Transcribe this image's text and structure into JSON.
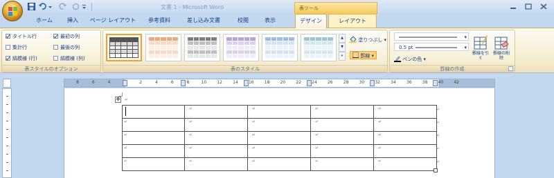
{
  "window": {
    "title": "文書 1 - Microsoft Word",
    "context_group": "表ツール"
  },
  "tabs": [
    {
      "label": "ホーム"
    },
    {
      "label": "挿入"
    },
    {
      "label": "ページ レイアウト"
    },
    {
      "label": "参考資料"
    },
    {
      "label": "差し込み文書"
    },
    {
      "label": "校閲"
    },
    {
      "label": "表示"
    },
    {
      "label": "デザイン"
    },
    {
      "label": "レイアウト"
    }
  ],
  "active_tab": "デザイン",
  "ribbon": {
    "style_options": {
      "label": "表スタイルのオプション",
      "items": [
        {
          "label": "タイトル行",
          "checked": true
        },
        {
          "label": "最初の列",
          "checked": true
        },
        {
          "label": "集計行",
          "checked": false
        },
        {
          "label": "最後の列",
          "checked": false
        },
        {
          "label": "縞模様 (行)",
          "checked": true
        },
        {
          "label": "縞模様 (列)",
          "checked": false
        }
      ]
    },
    "table_styles": {
      "label": "表のスタイル",
      "shading_label": "塗りつぶし",
      "borders_label": "罫線",
      "styles": [
        {
          "name": "grid-plain",
          "header": "#555555",
          "band": "#d9d9d9",
          "cell": "#ffffff"
        },
        {
          "name": "orange-grid",
          "header": "#f2a77a",
          "band": "#fbd9c4",
          "cell": "#fdeee4"
        },
        {
          "name": "grey-dark",
          "header": "#7f7f7f",
          "band": "#bfbfbf",
          "cell": "#e6e6e6"
        },
        {
          "name": "purple-light",
          "header": "#b8a4d6",
          "band": "#ddd2ee",
          "cell": "#f0ebf8"
        },
        {
          "name": "blue-light",
          "header": "#9dbbe3",
          "band": "#d4e2f5",
          "cell": "#ecf2fb"
        },
        {
          "name": "blue-green",
          "header": "#9cc6d6",
          "band": "#d3e8f0",
          "cell": "#ebf5f8"
        }
      ]
    },
    "draw_borders": {
      "label": "罫線の作成",
      "pen_weight": "0.5 pt",
      "pen_color_label": "ペンの色",
      "draw_table_label": "罫線を引く",
      "eraser_label": "罫線の削除"
    }
  },
  "ruler": {
    "numbers": [
      "8",
      "6",
      "4",
      "2",
      "2",
      "4",
      "6",
      "8",
      "10",
      "12",
      "14",
      "16",
      "18",
      "20",
      "22",
      "24",
      "26",
      "28",
      "30",
      "32",
      "34",
      "36",
      "38",
      "40",
      "42"
    ]
  },
  "document": {
    "table": {
      "rows": 5,
      "cols": 5,
      "cell_mark": "↵"
    }
  },
  "colors": {
    "ribbon_bg": "#f6edd0",
    "context_tab": "#f8c85a",
    "accent": "#15428b"
  }
}
